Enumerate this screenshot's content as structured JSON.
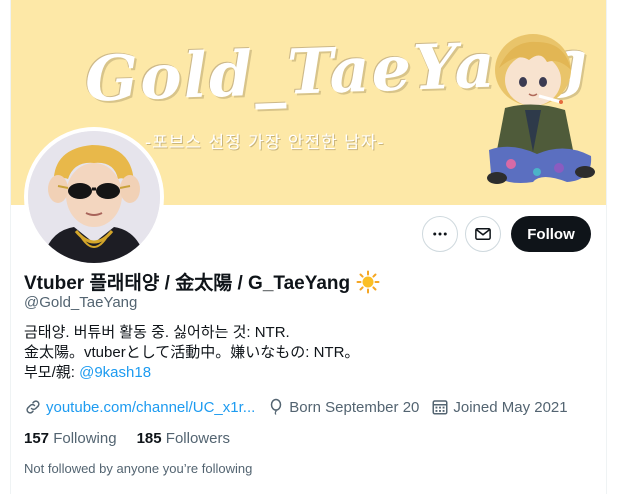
{
  "banner": {
    "title": "Gold_TaeYang",
    "subtitle": "-포브스 선정 가장 안전한 남자-"
  },
  "actions": {
    "follow_label": "Follow"
  },
  "profile": {
    "display_name": "Vtuber 플래태양 / 金太陽 / G_TaeYang",
    "handle": "@Gold_TaeYang",
    "bio_line1": "금태양. 버튜버 활동 중. 싫어하는 것: NTR.",
    "bio_line2": "金太陽。vtuberとして活動中。嫌いなもの: NTR。",
    "bio_line3_prefix": "부모/親: ",
    "bio_mention": "@9kash18"
  },
  "meta": {
    "website": "youtube.com/channel/UC_x1r...",
    "birthday": "Born September 20",
    "joined": "Joined May 2021"
  },
  "stats": {
    "following_count": "157",
    "following_label": "Following",
    "followers_count": "185",
    "followers_label": "Followers"
  },
  "footer": {
    "not_followed_text": "Not followed by anyone you’re following"
  },
  "colors": {
    "banner_bg": "#fde8a7",
    "accent_link": "#1d9bf0",
    "follow_bg": "#0f1419",
    "secondary_text": "#536471"
  },
  "icons": [
    "more-icon",
    "mail-icon",
    "sun-emoji",
    "link-icon",
    "balloon-icon",
    "calendar-icon"
  ]
}
